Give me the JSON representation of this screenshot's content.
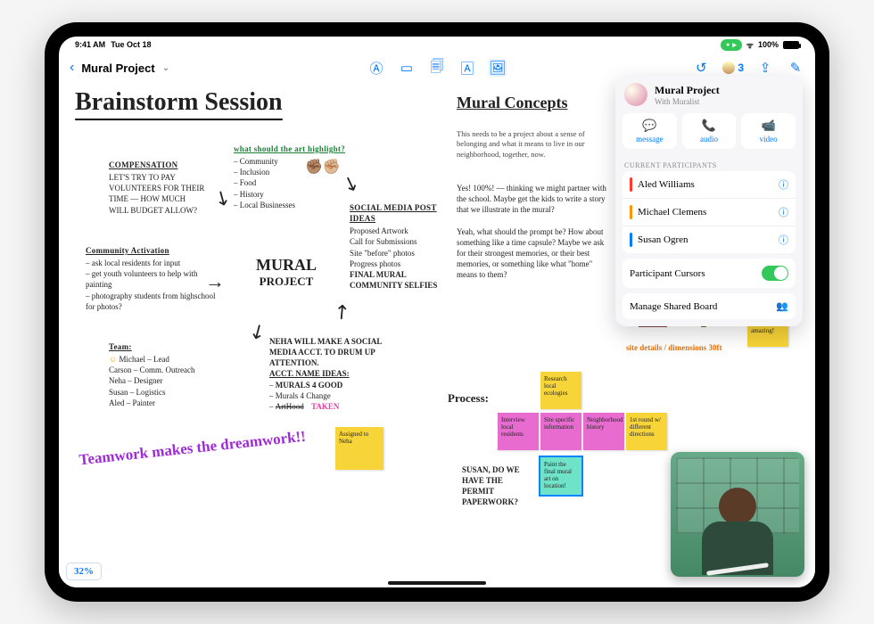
{
  "status": {
    "time": "9:41 AM",
    "date": "Tue Oct 18",
    "battery": "100%",
    "recording": true
  },
  "toolbar": {
    "title": "Mural Project",
    "tools": [
      "text-icon",
      "shape-icon",
      "sticky-icon",
      "textbox-icon",
      "media-icon"
    ],
    "undo": "↺",
    "participants_count": "3"
  },
  "collab": {
    "title": "Mural Project",
    "subtitle": "With Muralist",
    "actions": {
      "message": "message",
      "audio": "audio",
      "video": "video"
    },
    "section_label": "CURRENT PARTICIPANTS",
    "participants": [
      {
        "name": "Aled Williams",
        "color": "#ff3b30"
      },
      {
        "name": "Michael Clemens",
        "color": "#ff9500"
      },
      {
        "name": "Susan Ogren",
        "color": "#007aff"
      }
    ],
    "cursors_label": "Participant Cursors",
    "cursors_on": true,
    "manage_label": "Manage Shared Board"
  },
  "canvas": {
    "title_left": "Brainstorm Session",
    "title_right": "Mural Concepts",
    "zoom": "32%",
    "compensation": {
      "heading": "COMPENSATION",
      "body": "LET'S TRY TO PAY VOLUNTEERS FOR THEIR TIME — HOW MUCH WILL BUDGET ALLOW?"
    },
    "highlight": {
      "heading": "what should the art highlight?",
      "items": [
        "Community",
        "Inclusion",
        "Food",
        "History",
        "Local Businesses"
      ]
    },
    "activation": {
      "heading": "Community Activation",
      "items": [
        "ask local residents for input",
        "get youth volunteers to help with painting",
        "photography students from highschool for photos?"
      ]
    },
    "team": {
      "heading": "Team:",
      "items": [
        "Michael – Lead",
        "Carson – Comm. Outreach",
        "Neha – Designer",
        "Susan – Logistics",
        "Aled – Painter"
      ]
    },
    "badge_top": "MURAL",
    "badge_bottom": "PROJECT",
    "social": {
      "heading": "SOCIAL MEDIA POST IDEAS",
      "items": [
        "Proposed Artwork",
        "Call for Submissions",
        "Site \"before\" photos",
        "Progress photos",
        "FINAL MURAL",
        "COMMUNITY SELFIES"
      ]
    },
    "neha": {
      "body": "NEHA WILL MAKE A SOCIAL MEDIA ACCT. TO DRUM UP ATTENTION.",
      "sub": "ACCT. NAME IDEAS:",
      "items": [
        "MURALS 4 GOOD",
        "Murals 4 Change",
        "ArtHood"
      ],
      "taken": "TAKEN"
    },
    "teamwork": "Teamwork makes the dreamwork!!",
    "assigned_sticky": "Assigned to Neha",
    "concept_text": "This needs to be a project about a sense of belonging and what it means to live in our neighborhood, together, now.",
    "concept_reply": "Yes! 100%! — thinking we might partner with the school. Maybe get the kids to write a story that we illustrate in the mural?\n\nYeah, what should the prompt be? How about something like a time capsule? Maybe we ask for their strongest memories, or their best memories, or something like what \"home\" means to them?",
    "dim_note": "site details / dimensions 30ft",
    "wow_sticky": "Wow! This looks amazing!",
    "process_label": "Process:",
    "process_stickies": [
      {
        "text": "Research local ecologies",
        "color": "#f7d437"
      },
      {
        "text": "Interview local residents",
        "color": "#e86bd0"
      },
      {
        "text": "Site specific information",
        "color": "#e86bd0"
      },
      {
        "text": "Neighborhood history",
        "color": "#e86bd0"
      },
      {
        "text": "1st round w/ different directions",
        "color": "#f7d437"
      },
      {
        "text": "Paint the final mural art on location!",
        "color": "#6fe3c8"
      }
    ],
    "susan_note": "SUSAN, DO WE HAVE THE PERMIT PAPERWORK?"
  }
}
